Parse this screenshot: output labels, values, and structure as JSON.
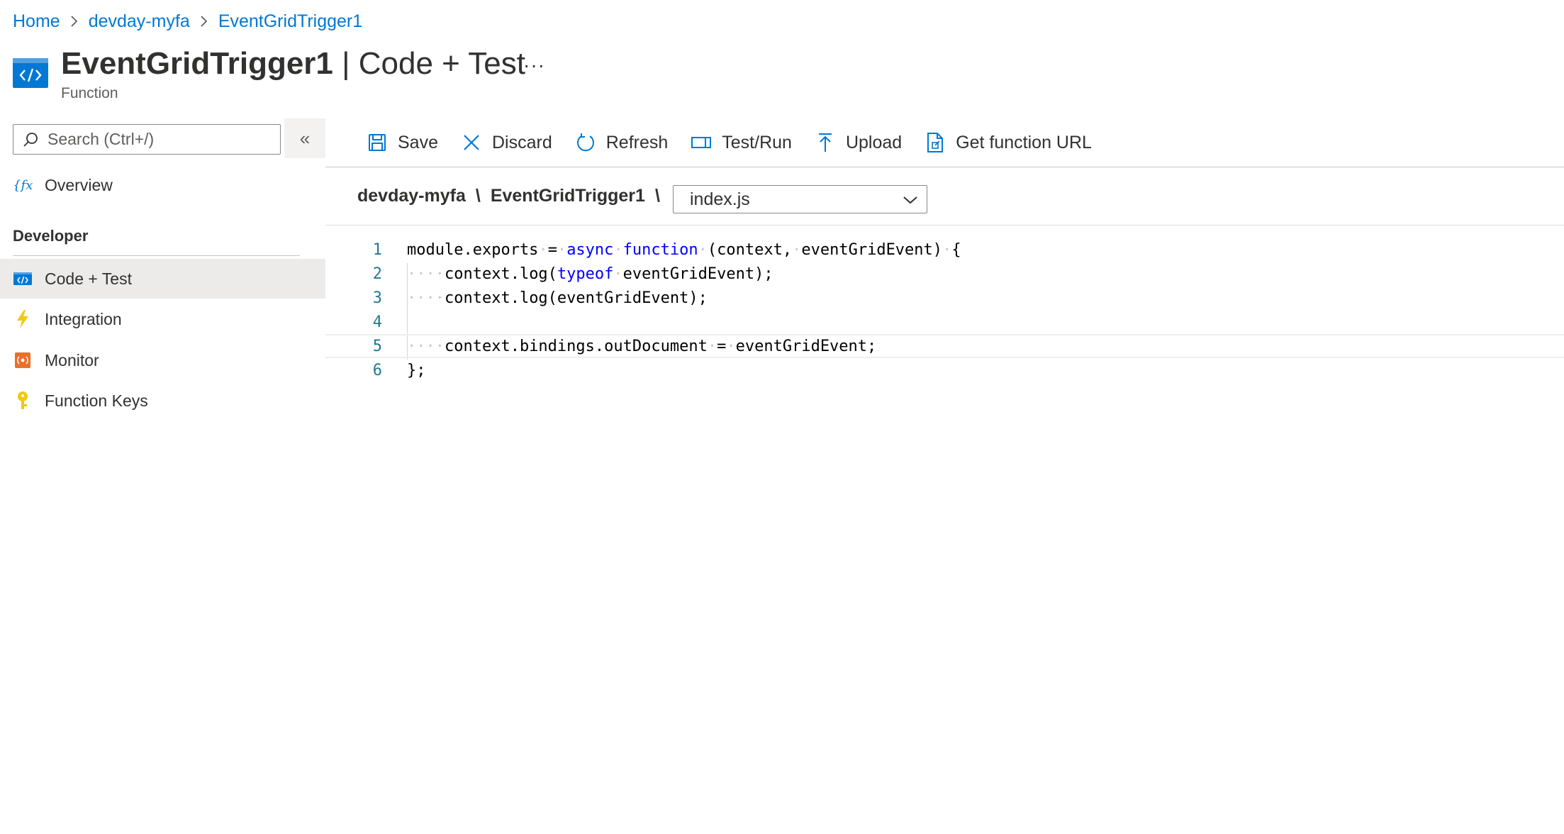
{
  "breadcrumb": {
    "items": [
      "Home",
      "devday-myfa",
      "EventGridTrigger1"
    ]
  },
  "header": {
    "title_main": "EventGridTrigger1",
    "title_rest": " | Code + Test",
    "more": "···",
    "subtitle": "Function",
    "icon": "function-code-icon"
  },
  "sidebar": {
    "search_placeholder": "Search (Ctrl+/)",
    "collapse_label": "«",
    "overview": {
      "label": "Overview",
      "icon": "function-fx-icon"
    },
    "section_title": "Developer",
    "items": [
      {
        "label": "Code + Test",
        "icon": "code-icon",
        "active": true
      },
      {
        "label": "Integration",
        "icon": "lightning-icon"
      },
      {
        "label": "Monitor",
        "icon": "monitor-icon"
      },
      {
        "label": "Function Keys",
        "icon": "key-icon"
      }
    ]
  },
  "toolbar": {
    "save": "Save",
    "discard": "Discard",
    "refresh": "Refresh",
    "test_run": "Test/Run",
    "upload": "Upload",
    "get_url": "Get function URL"
  },
  "path": {
    "app": "devday-myfa",
    "function": "EventGridTrigger1",
    "separator": "\\",
    "file": "index.js"
  },
  "editor": {
    "line_numbers": [
      "1",
      "2",
      "3",
      "4",
      "5",
      "6"
    ],
    "colors": {
      "keyword": "#0000ff",
      "line_number": "#237893"
    }
  },
  "colors": {
    "accent": "#0078d4",
    "active_nav_bg": "#edebe9"
  }
}
